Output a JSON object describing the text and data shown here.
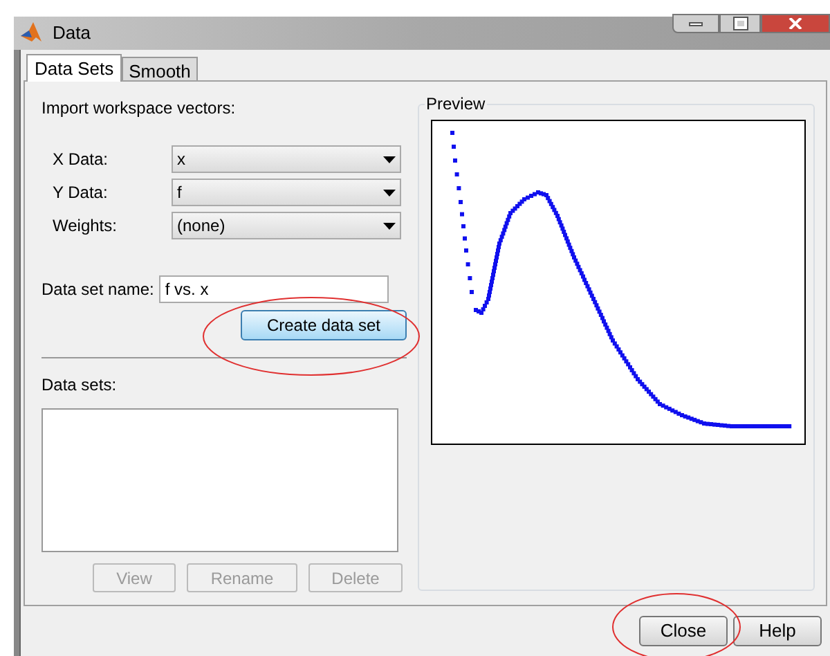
{
  "window": {
    "title": "Data"
  },
  "tabs": [
    {
      "label": "Data Sets",
      "selected": true
    },
    {
      "label": "Smooth",
      "selected": false
    }
  ],
  "import": {
    "heading": "Import workspace vectors:",
    "fields": [
      {
        "label": "X Data:",
        "value": "x"
      },
      {
        "label": "Y Data:",
        "value": "f"
      },
      {
        "label": "Weights:",
        "value": "(none)"
      }
    ],
    "name_label": "Data set name:",
    "name_value": "f vs. x",
    "create_button": "Create data set"
  },
  "data_sets": {
    "label": "Data sets:",
    "buttons": [
      {
        "label": "View",
        "disabled": true
      },
      {
        "label": "Rename",
        "disabled": true
      },
      {
        "label": "Delete",
        "disabled": true
      }
    ]
  },
  "preview": {
    "title": "Preview"
  },
  "buttons": [
    {
      "label": "Close"
    },
    {
      "label": "Help"
    }
  ]
}
